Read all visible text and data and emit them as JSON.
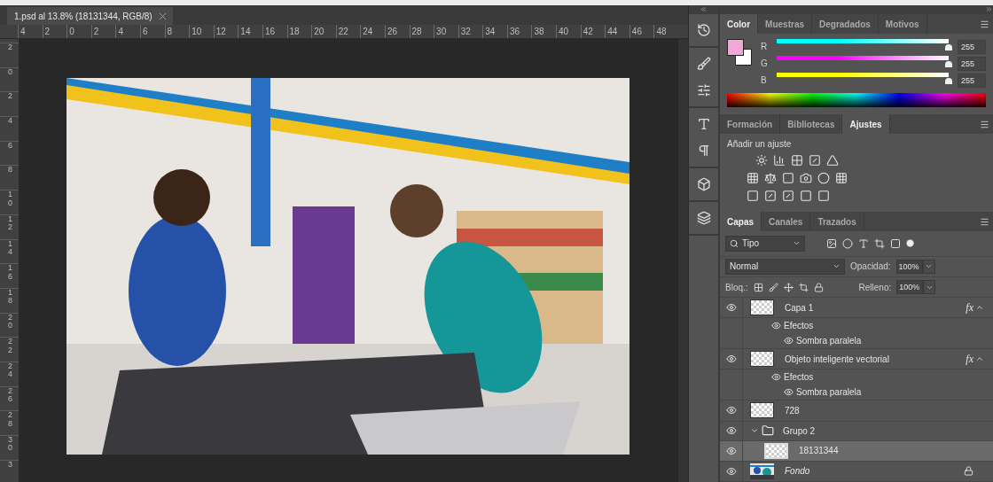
{
  "document_tab": {
    "title": "1.psd al 13.8% (18131344, RGB/8)",
    "selected": true
  },
  "ruler_horizontal": [
    "4",
    "2",
    "0",
    "2",
    "4",
    "6",
    "8",
    "10",
    "12",
    "14",
    "16",
    "18",
    "20",
    "22",
    "24",
    "26",
    "28",
    "30",
    "32",
    "34",
    "36",
    "38",
    "40",
    "42",
    "44",
    "46",
    "48"
  ],
  "ruler_vertical": [
    "2",
    "0",
    "2",
    "4",
    "6",
    "8",
    "10",
    "12",
    "14",
    "16",
    "18",
    "20",
    "22",
    "24",
    "26",
    "28",
    "30",
    "3"
  ],
  "color_panel": {
    "tabs": [
      {
        "label": "Color",
        "selected": true
      },
      {
        "label": "Muestras",
        "selected": false
      },
      {
        "label": "Degradados",
        "selected": false
      },
      {
        "label": "Motivos",
        "selected": false
      }
    ],
    "foreground": {
      "color": "#f5a6d8"
    },
    "background": {
      "color": "#ffffff"
    },
    "sliders": [
      {
        "label": "R",
        "level": 1,
        "value": "255",
        "color": "#00ffff"
      },
      {
        "label": "G",
        "level": 1,
        "value": "255",
        "color": "#ff00ff"
      },
      {
        "label": "B",
        "level": 1,
        "value": "255",
        "color": "#ffff00"
      }
    ]
  },
  "adjustments_panel": {
    "tabs": [
      {
        "label": "Formación",
        "selected": false
      },
      {
        "label": "Bibliotecas",
        "selected": false
      },
      {
        "label": "Ajustes",
        "selected": true
      }
    ],
    "heading": "Añadir un ajuste"
  },
  "layers_panel": {
    "tabs": [
      {
        "label": "Capas",
        "selected": true
      },
      {
        "label": "Canales",
        "selected": false
      },
      {
        "label": "Trazados",
        "selected": false
      }
    ],
    "filter": "Tipo",
    "blend_mode": "Normal",
    "opacity_label": "Opacidad:",
    "opacity": "100%",
    "lock_label": "Bloq.:",
    "fill_label": "Relleno:",
    "fill": "100%",
    "layers": [
      {
        "name": "Capa 1",
        "kind": "layer",
        "visible": true,
        "selected": false,
        "fx": "fx",
        "effects": {
          "label": "Efectos",
          "items": [
            "Sombra paralela"
          ]
        }
      },
      {
        "name": "Objeto inteligente vectorial",
        "kind": "layer",
        "visible": true,
        "selected": false,
        "fx": "fx",
        "effects": {
          "label": "Efectos",
          "items": [
            "Sombra paralela"
          ]
        }
      },
      {
        "name": "728",
        "kind": "layer",
        "visible": true,
        "selected": false
      },
      {
        "name": "Grupo 2",
        "kind": "group",
        "visible": true,
        "selected": false,
        "expanded": true,
        "children": [
          {
            "name": "18131344",
            "kind": "smart",
            "visible": true,
            "selected": true
          }
        ]
      },
      {
        "name": "Fondo",
        "kind": "background",
        "visible": true,
        "selected": false,
        "locked": true
      }
    ]
  }
}
